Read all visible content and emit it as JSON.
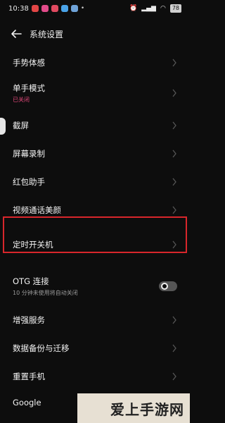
{
  "status_bar": {
    "time": "10:38",
    "battery": "78"
  },
  "header": {
    "title": "系统设置"
  },
  "items": [
    {
      "label": "手势体感"
    },
    {
      "label": "单手模式",
      "sub": "已关闭"
    },
    {
      "label": "截屏"
    },
    {
      "label": "屏幕录制"
    },
    {
      "label": "红包助手"
    },
    {
      "label": "视频通话美颜"
    },
    {
      "label": "定时开关机"
    },
    {
      "label": "OTG 连接",
      "sub": "10 分钟未使用将自动关闭"
    },
    {
      "label": "增强服务"
    },
    {
      "label": "数据备份与迁移"
    },
    {
      "label": "重置手机"
    },
    {
      "label": "Google"
    }
  ],
  "toggle": {
    "state": "off"
  },
  "watermark": "爱上手游网",
  "colors": {
    "background": "#0d0d0d",
    "sub_text_pink": "#e2487a",
    "sub_text_gray": "#9a9a9a",
    "highlight": "#d8262b"
  }
}
